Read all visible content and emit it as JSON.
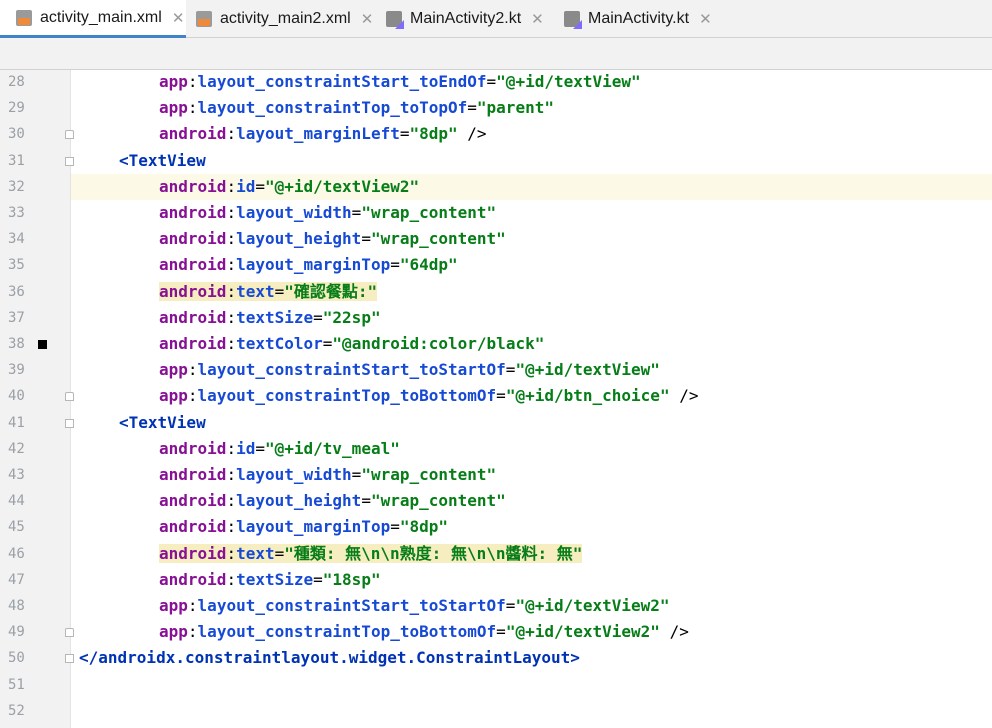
{
  "tabs": [
    {
      "label": "activity_main.xml",
      "icon": "xml-file-icon",
      "active": true
    },
    {
      "label": "activity_main2.xml",
      "icon": "xml-file-icon",
      "active": false
    },
    {
      "label": "MainActivity2.kt",
      "icon": "kotlin-file-icon",
      "active": false
    },
    {
      "label": "MainActivity.kt",
      "icon": "kotlin-file-icon",
      "active": false
    }
  ],
  "close_glyph": "✕",
  "lines": [
    {
      "n": "28",
      "ns": "app",
      "attr": "layout_constraintStart_toEndOf",
      "val": "\"@+id/textView\"",
      "tail": ""
    },
    {
      "n": "29",
      "ns": "app",
      "attr": "layout_constraintTop_toTopOf",
      "val": "\"parent\"",
      "tail": ""
    },
    {
      "n": "30",
      "ns": "android",
      "attr": "layout_marginLeft",
      "val": "\"8dp\"",
      "tail": " />"
    },
    {
      "n": "31",
      "tag": "<TextView"
    },
    {
      "n": "32",
      "ns": "android",
      "attr": "id",
      "val": "\"@+id/textView2\"",
      "tail": ""
    },
    {
      "n": "33",
      "ns": "android",
      "attr": "layout_width",
      "val": "\"wrap_content\"",
      "tail": ""
    },
    {
      "n": "34",
      "ns": "android",
      "attr": "layout_height",
      "val": "\"wrap_content\"",
      "tail": ""
    },
    {
      "n": "35",
      "ns": "android",
      "attr": "layout_marginTop",
      "val": "\"64dp\"",
      "tail": ""
    },
    {
      "n": "36",
      "ns": "android",
      "attr": "text",
      "val": "\"確認餐點:\"",
      "tail": ""
    },
    {
      "n": "37",
      "ns": "android",
      "attr": "textSize",
      "val": "\"22sp\"",
      "tail": ""
    },
    {
      "n": "38",
      "ns": "android",
      "attr": "textColor",
      "val": "\"@android:color/black\"",
      "tail": ""
    },
    {
      "n": "39",
      "ns": "app",
      "attr": "layout_constraintStart_toStartOf",
      "val": "\"@+id/textView\"",
      "tail": ""
    },
    {
      "n": "40",
      "ns": "app",
      "attr": "layout_constraintTop_toBottomOf",
      "val": "\"@+id/btn_choice\"",
      "tail": " />"
    },
    {
      "n": "41",
      "tag": "<TextView"
    },
    {
      "n": "42",
      "ns": "android",
      "attr": "id",
      "val": "\"@+id/tv_meal\"",
      "tail": ""
    },
    {
      "n": "43",
      "ns": "android",
      "attr": "layout_width",
      "val": "\"wrap_content\"",
      "tail": ""
    },
    {
      "n": "44",
      "ns": "android",
      "attr": "layout_height",
      "val": "\"wrap_content\"",
      "tail": ""
    },
    {
      "n": "45",
      "ns": "android",
      "attr": "layout_marginTop",
      "val": "\"8dp\"",
      "tail": ""
    },
    {
      "n": "46",
      "ns": "android",
      "attr": "text",
      "val": "\"種類: 無\\n\\n熟度: 無\\n\\n醬料: 無\"",
      "tail": ""
    },
    {
      "n": "47",
      "ns": "android",
      "attr": "textSize",
      "val": "\"18sp\"",
      "tail": ""
    },
    {
      "n": "48",
      "ns": "app",
      "attr": "layout_constraintStart_toStartOf",
      "val": "\"@+id/textView2\"",
      "tail": ""
    },
    {
      "n": "49",
      "ns": "app",
      "attr": "layout_constraintTop_toBottomOf",
      "val": "\"@+id/textView2\"",
      "tail": " />"
    },
    {
      "n": "50",
      "tag": "</androidx.constraintlayout.widget.ConstraintLayout>"
    },
    {
      "n": "51"
    },
    {
      "n": "52"
    }
  ]
}
